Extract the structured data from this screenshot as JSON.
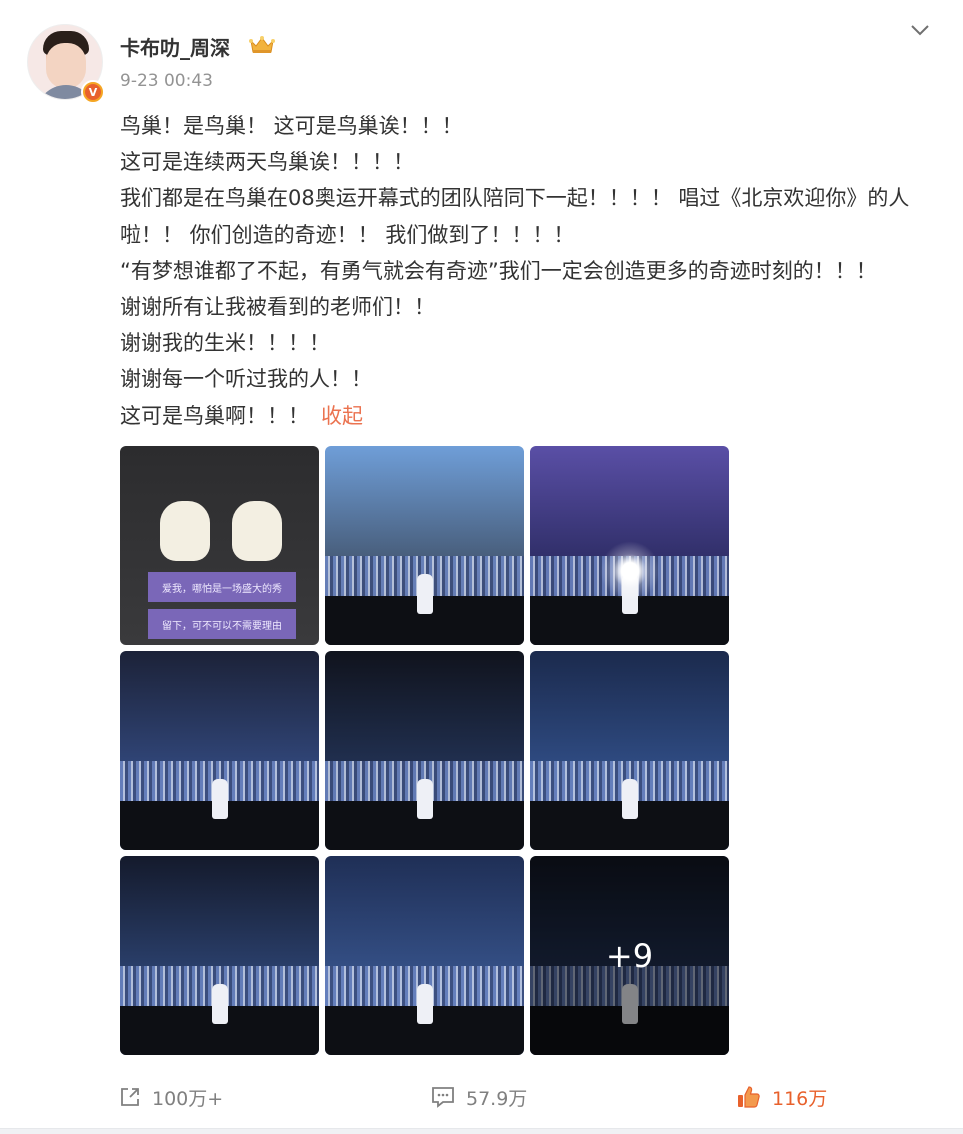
{
  "post": {
    "username": "卡布叻_周深",
    "timestamp": "9-23 00:43",
    "lines": [
      "鸟巢！是鸟巢！ 这可是鸟巢诶！！！",
      "这可是连续两天鸟巢诶！！！！",
      "我们都是在鸟巢在08奥运开幕式的团队陪同下一起！！！！ 唱过《北京欢迎你》的人啦！！ 你们创造的奇迹！！ 我们做到了！！！！",
      "“有梦想谁都了不起，有勇气就会有奇迹”我们一定会创造更多的奇迹时刻的！！！",
      "谢谢所有让我被看到的老师们！！",
      "谢谢我的生米！！！！",
      "谢谢每一个听过我的人！！",
      "这可是鸟巢啊！！！"
    ],
    "collapse_label": "收起",
    "photo_tiles": [
      {
        "name": "photo-stickers",
        "colors": [
          "#2c2c2e",
          "#3a3a3c"
        ]
      },
      {
        "name": "photo-team-group",
        "colors": [
          "#6f9ed8",
          "#2a2c33"
        ]
      },
      {
        "name": "photo-stage-spotlight",
        "colors": [
          "#5a4fa6",
          "#10163a"
        ]
      },
      {
        "name": "photo-stadium-1",
        "colors": [
          "#1c2238",
          "#3f5fa6"
        ]
      },
      {
        "name": "photo-stadium-2",
        "colors": [
          "#10131d",
          "#2d4576"
        ]
      },
      {
        "name": "photo-stadium-3",
        "colors": [
          "#1b2a4d",
          "#3d63a8"
        ]
      },
      {
        "name": "photo-stadium-4",
        "colors": [
          "#141a2c",
          "#3b5b9a"
        ]
      },
      {
        "name": "photo-stadium-5",
        "colors": [
          "#1f2f56",
          "#4467a8"
        ]
      },
      {
        "name": "photo-stadium-6",
        "colors": [
          "#121723",
          "#2b4273"
        ]
      }
    ],
    "sticker_text_1": "爱我，哪怕是一场盛大的秀",
    "sticker_text_2": "留下，可不可以不需要理由",
    "more_count": "+9"
  },
  "footer": {
    "share_count": "100万+",
    "comment_count": "57.9万",
    "like_count": "116万"
  },
  "colors": {
    "accent": "#eb7350",
    "like": "#e8612c",
    "muted": "#939393"
  }
}
